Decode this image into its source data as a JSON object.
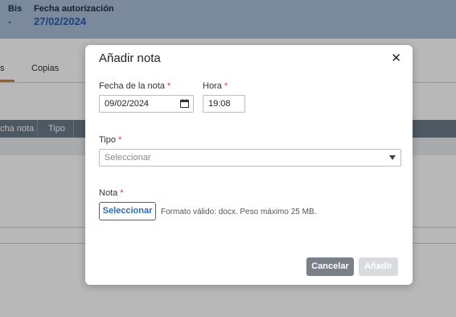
{
  "background": {
    "header": {
      "bis_label": "Bis",
      "bis_value": "-",
      "fecha_autorizacion_label": "Fecha autorización",
      "fecha_autorizacion_value": "27/02/2024"
    },
    "tabs": [
      "s",
      "Copias"
    ],
    "table_headers": [
      "cha nota",
      "Tipo"
    ]
  },
  "modal": {
    "title": "Añadir nota",
    "close_symbol": "✕",
    "required_mark": "*",
    "fecha_label": "Fecha de la nota",
    "fecha_value": "09/02/2024",
    "hora_label": "Hora",
    "hora_value": "19:08",
    "tipo_label": "Tipo",
    "tipo_placeholder": "Seleccionar",
    "nota_label": "Nota",
    "select_file_button": "Seleccionar",
    "file_hint": "Formato válido: docx. Peso máximo 25 MB.",
    "cancel_button": "Cancelar",
    "add_button": "Añadir"
  },
  "colors": {
    "header_bg": "#a9bfd8",
    "accent_blue": "#2b6cb0",
    "required_red": "#d9363e",
    "cancel_bg": "#7a8087",
    "add_disabled_bg": "#d9dcdf"
  }
}
